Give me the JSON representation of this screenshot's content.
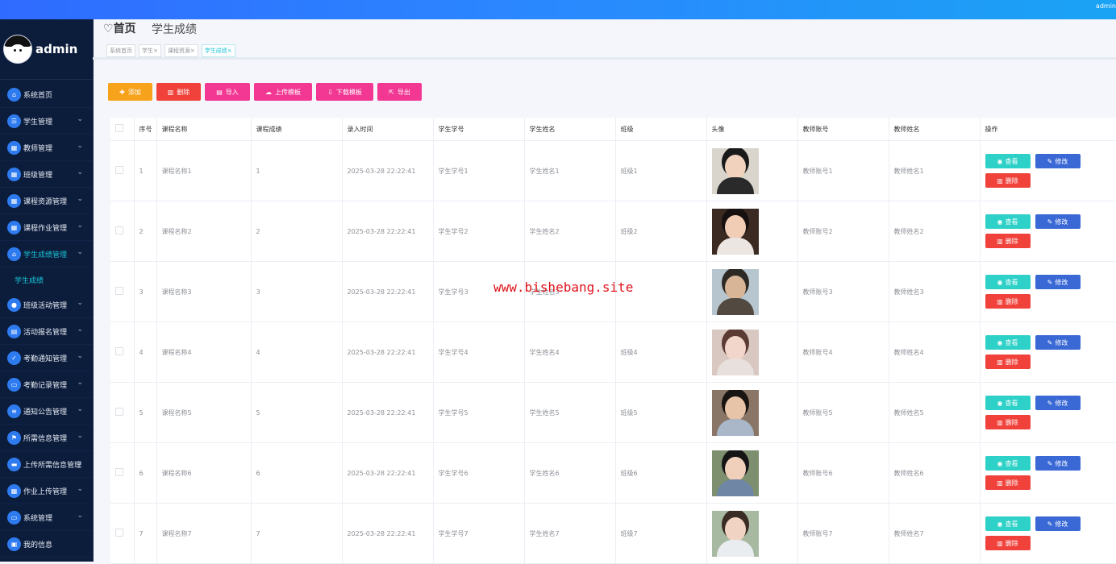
{
  "header": {
    "user": "admin"
  },
  "sidebar": {
    "brand": "admin",
    "items": [
      {
        "label": "系统首页",
        "icon": "home-icon",
        "glyph": "⌂",
        "expandable": false
      },
      {
        "label": "学生管理",
        "icon": "sliders-icon",
        "glyph": "☰",
        "expandable": true
      },
      {
        "label": "教师管理",
        "icon": "grid-icon",
        "glyph": "▦",
        "expandable": true
      },
      {
        "label": "班级管理",
        "icon": "grid-icon",
        "glyph": "▦",
        "expandable": true
      },
      {
        "label": "课程资源管理",
        "icon": "grid-icon",
        "glyph": "▦",
        "expandable": true
      },
      {
        "label": "课程作业管理",
        "icon": "grid-icon",
        "glyph": "▦",
        "expandable": true
      },
      {
        "label": "学生成绩管理",
        "icon": "bag-icon",
        "glyph": "⌂",
        "expandable": true,
        "active": true,
        "sub": "学生成绩"
      },
      {
        "label": "班级活动管理",
        "icon": "user-icon",
        "glyph": "●",
        "expandable": true
      },
      {
        "label": "活动报名管理",
        "icon": "clipboard-icon",
        "glyph": "▤",
        "expandable": true
      },
      {
        "label": "考勤通知管理",
        "icon": "clipboard-check-icon",
        "glyph": "✓",
        "expandable": true
      },
      {
        "label": "考勤记录管理",
        "icon": "monitor-icon",
        "glyph": "▭",
        "expandable": true
      },
      {
        "label": "通知公告管理",
        "icon": "list-icon",
        "glyph": "≡",
        "expandable": true
      },
      {
        "label": "所需信息管理",
        "icon": "flag-icon",
        "glyph": "⚑",
        "expandable": true
      },
      {
        "label": "上传所需信息管理",
        "icon": "chat-icon",
        "glyph": "▬",
        "expandable": true
      },
      {
        "label": "作业上传管理",
        "icon": "grid-icon",
        "glyph": "▦",
        "expandable": true
      },
      {
        "label": "系统管理",
        "icon": "monitor-icon",
        "glyph": "▭",
        "expandable": true
      },
      {
        "label": "我的信息",
        "icon": "id-card-icon",
        "glyph": "▣",
        "expandable": false
      }
    ]
  },
  "breadcrumb": {
    "home": "♡首页",
    "current": "学生成绩"
  },
  "tags": [
    {
      "label": "系统首页",
      "active": false
    },
    {
      "label": "学生×",
      "active": false
    },
    {
      "label": "课程资源×",
      "active": false
    },
    {
      "label": "学生成绩×",
      "active": true
    }
  ],
  "toolbar": {
    "add": "添加",
    "delete": "删除",
    "import": "导入",
    "upload_template": "上传模板",
    "download_template": "下载模板",
    "export": "导出"
  },
  "table": {
    "columns": [
      "序号",
      "课程名称",
      "课程成绩",
      "录入时间",
      "学生学号",
      "学生姓名",
      "班级",
      "头像",
      "教师账号",
      "教师姓名",
      "操作"
    ],
    "rows": [
      {
        "no": "1",
        "course": "课程名称1",
        "score": "1",
        "time": "2025-03-28 22:22:41",
        "sid": "学生学号1",
        "sname": "学生姓名1",
        "class": "班级1",
        "tid": "教师账号1",
        "tname": "教师姓名1"
      },
      {
        "no": "2",
        "course": "课程名称2",
        "score": "2",
        "time": "2025-03-28 22:22:41",
        "sid": "学生学号2",
        "sname": "学生姓名2",
        "class": "班级2",
        "tid": "教师账号2",
        "tname": "教师姓名2"
      },
      {
        "no": "3",
        "course": "课程名称3",
        "score": "3",
        "time": "2025-03-28 22:22:41",
        "sid": "学生学号3",
        "sname": "学生姓名3",
        "class": "",
        "tid": "教师账号3",
        "tname": "教师姓名3"
      },
      {
        "no": "4",
        "course": "课程名称4",
        "score": "4",
        "time": "2025-03-28 22:22:41",
        "sid": "学生学号4",
        "sname": "学生姓名4",
        "class": "班级4",
        "tid": "教师账号4",
        "tname": "教师姓名4"
      },
      {
        "no": "5",
        "course": "课程名称5",
        "score": "5",
        "time": "2025-03-28 22:22:41",
        "sid": "学生学号5",
        "sname": "学生姓名5",
        "class": "班级5",
        "tid": "教师账号5",
        "tname": "教师姓名5"
      },
      {
        "no": "6",
        "course": "课程名称6",
        "score": "6",
        "time": "2025-03-28 22:22:41",
        "sid": "学生学号6",
        "sname": "学生姓名6",
        "class": "班级6",
        "tid": "教师账号6",
        "tname": "教师姓名6"
      },
      {
        "no": "7",
        "course": "课程名称7",
        "score": "7",
        "time": "2025-03-28 22:22:41",
        "sid": "学生学号7",
        "sname": "学生姓名7",
        "class": "班级7",
        "tid": "教师账号7",
        "tname": "教师姓名7"
      }
    ],
    "actions": {
      "view": "查看",
      "edit": "修改",
      "delete": "删除"
    }
  },
  "watermark": "www.bishebang.site",
  "colors": {
    "accent": "#19c3d6",
    "sidebar": "#0c1d3c",
    "danger": "#f0413a",
    "pink": "#f23893",
    "orange": "#f7a21b"
  }
}
